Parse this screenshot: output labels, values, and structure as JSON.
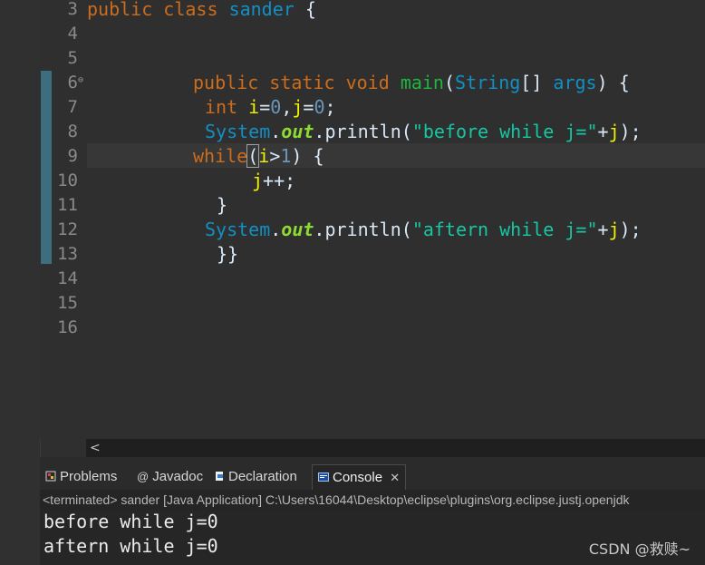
{
  "editor": {
    "line_numbers": [
      "3",
      "4",
      "5",
      "6",
      "7",
      "8",
      "9",
      "10",
      "11",
      "12",
      "13",
      "14",
      "15",
      "16"
    ],
    "fold_marker": "⊖",
    "lines": {
      "l3": {
        "kw1": "public",
        "kw2": "class",
        "name": "sander",
        "brace": "{"
      },
      "l6": {
        "kw1": "public",
        "kw2": "static",
        "kw3": "void",
        "fn": "main",
        "p1": "(",
        "type": "String",
        "arr": "[]",
        "arg": "args",
        "p2": ")",
        "brace": "{"
      },
      "l7": {
        "kw": "int",
        "v1": "i",
        "eq1": "=",
        "n1": "0",
        "comma": ",",
        "v2": "j",
        "eq2": "=",
        "n2": "0",
        "semi": ";"
      },
      "l8": {
        "cls": "System",
        "dot1": ".",
        "field": "out",
        "dot2": ".",
        "fn": "println",
        "p1": "(",
        "str": "\"before while j=\"",
        "plus": "+",
        "v": "j",
        "p2": ");"
      },
      "l9": {
        "kw": "while",
        "p1": "(",
        "v": "i",
        "op": ">",
        "n": "1",
        "p2": ")",
        "brace": "{"
      },
      "l10": {
        "v": "j",
        "op": "++;"
      },
      "l11": {
        "brace": "}"
      },
      "l12": {
        "cls": "System",
        "dot1": ".",
        "field": "out",
        "dot2": ".",
        "fn": "println",
        "p1": "(",
        "str": "\"aftern while j=\"",
        "plus": "+",
        "v": "j",
        "p2": ");"
      },
      "l13": {
        "brace": "}}"
      }
    },
    "scroll_arrow": "<"
  },
  "tabs": {
    "problems": "Problems",
    "javadoc": "Javadoc",
    "declaration": "Declaration",
    "console": "Console",
    "console_close": "✕",
    "javadoc_icon": "@"
  },
  "console": {
    "status": "<terminated> sander [Java Application] C:\\Users\\16044\\Desktop\\eclipse\\plugins\\org.eclipse.justj.openjdk",
    "output": [
      "before while j=0",
      "aftern while j=0"
    ]
  },
  "watermark": "CSDN @救赎~",
  "colors": {
    "background": "#2f2f2f",
    "keyword": "#cc6c1d",
    "type": "#1290c3",
    "method": "#1eb540",
    "variable": "#f2f200",
    "string": "#17c6a3",
    "field": "#8dda33"
  }
}
